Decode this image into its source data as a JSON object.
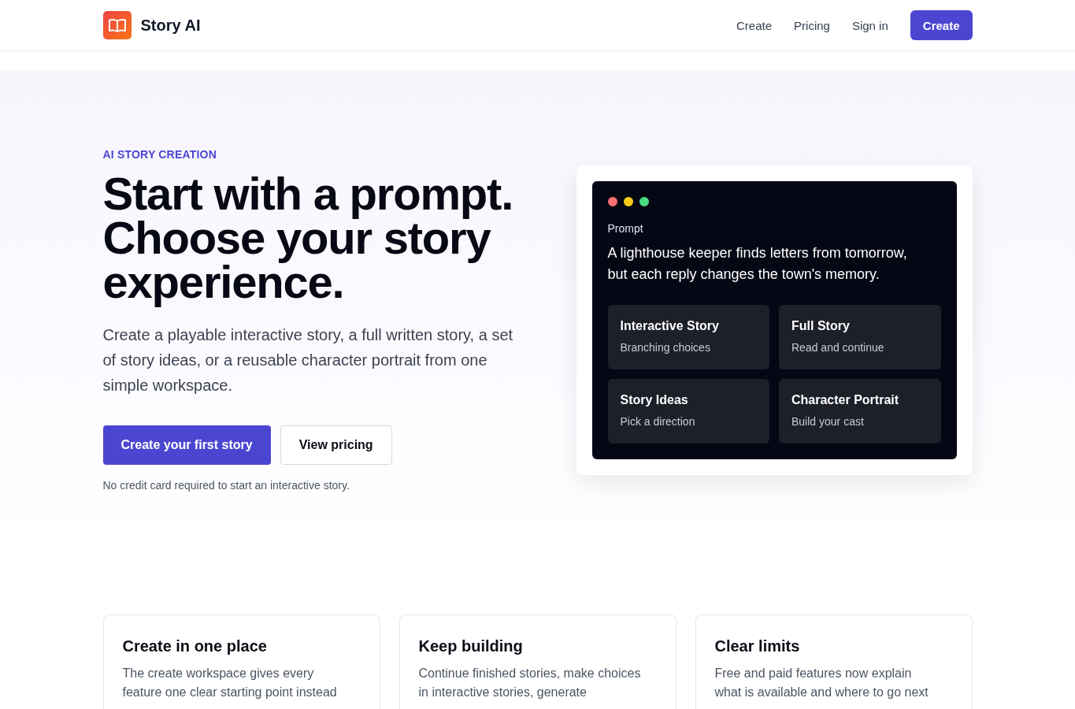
{
  "nav": {
    "brand": "Story AI",
    "links": [
      "Create",
      "Pricing",
      "Sign in"
    ],
    "cta": "Create"
  },
  "hero": {
    "eyebrow": "AI STORY CREATION",
    "title": "Start with a prompt. Choose your story experience.",
    "description": "Create a playable interactive story, a full written story, a set of story ideas, or a reusable character portrait from one simple workspace.",
    "buttons": [
      {
        "label": "Create your first story",
        "kind": "primary"
      },
      {
        "label": "View pricing",
        "kind": "secondary"
      }
    ],
    "note": "No credit card required to start an interactive story."
  },
  "preview": {
    "label": "Prompt",
    "prompt": "A lighthouse keeper finds letters from tomorrow, but each reply changes the town's memory.",
    "options": [
      {
        "title": "Interactive Story",
        "subtitle": "Branching choices"
      },
      {
        "title": "Full Story",
        "subtitle": "Read and continue"
      },
      {
        "title": "Story Ideas",
        "subtitle": "Pick a direction"
      },
      {
        "title": "Character Portrait",
        "subtitle": "Build your cast"
      }
    ]
  },
  "features": [
    {
      "title": "Create in one place",
      "text": "The create workspace gives every feature one clear starting point instead"
    },
    {
      "title": "Keep building",
      "text": "Continue finished stories, make choices in interactive stories, generate"
    },
    {
      "title": "Clear limits",
      "text": "Free and paid features now explain what is available and where to go next"
    }
  ]
}
